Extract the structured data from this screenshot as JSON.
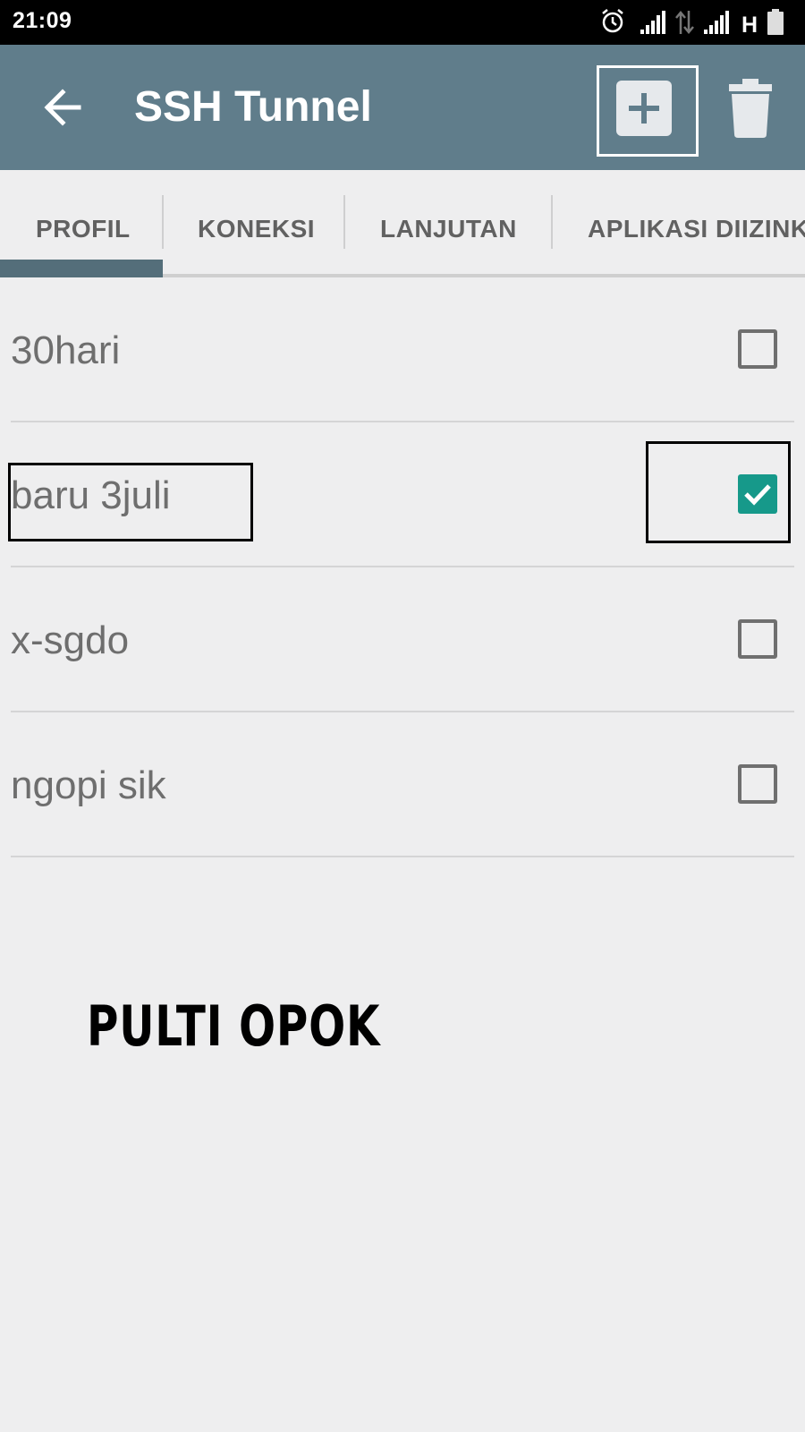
{
  "status_bar": {
    "time": "21:09",
    "icons": [
      "alarm-icon",
      "signal-icon",
      "data-arrows-icon",
      "signal-icon",
      "network-type-h",
      "battery-icon"
    ],
    "network_type": "H"
  },
  "app_bar": {
    "title": "SSH Tunnel",
    "color": "#607d8b",
    "actions": [
      "add-icon",
      "trash-icon"
    ]
  },
  "tabs": [
    {
      "label": "PROFIL",
      "selected": true
    },
    {
      "label": "KONEKSI",
      "selected": false
    },
    {
      "label": "LANJUTAN",
      "selected": false
    },
    {
      "label": "APLIKASI DIIZINK",
      "selected": false
    }
  ],
  "profiles": [
    {
      "name": "30hari",
      "checked": false
    },
    {
      "name": "baru 3juli",
      "checked": true
    },
    {
      "name": "x-sgdo",
      "checked": false
    },
    {
      "name": "ngopi sik",
      "checked": false
    }
  ],
  "watermark": "PULTI OPOK",
  "accent_color": "#16998a"
}
